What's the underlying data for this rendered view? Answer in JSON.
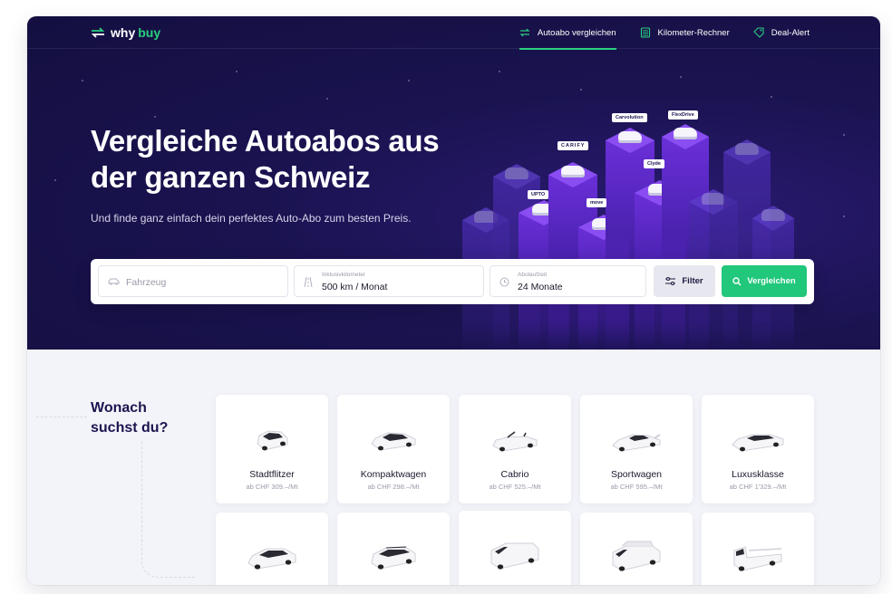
{
  "brand": {
    "name_part1": "why",
    "name_part2": "buy"
  },
  "nav": {
    "items": [
      {
        "label": "Autoabo vergleichen",
        "icon": "swap-arrows-icon",
        "active": true
      },
      {
        "label": "Kilometer-Rechner",
        "icon": "calculator-icon",
        "active": false
      },
      {
        "label": "Deal-Alert",
        "icon": "tag-icon",
        "active": false
      }
    ]
  },
  "hero": {
    "title": "Vergleiche Autoabos aus der ganzen Schweiz",
    "subtitle": "Und finde ganz einfach dein perfektes Auto-Abo zum besten Preis."
  },
  "illustration": {
    "brands": [
      "Carvolution",
      "FlexDrive",
      "CARIFY",
      "Clyde",
      "UPTO",
      "move"
    ]
  },
  "search": {
    "vehicle": {
      "placeholder": "Fahrzeug"
    },
    "km": {
      "label": "Inklusivkilometer",
      "value": "500 km / Monat"
    },
    "duration": {
      "label": "Abolaufzeit",
      "value": "24 Monate"
    },
    "filter_label": "Filter",
    "compare_label": "Vergleichen"
  },
  "categories": {
    "title_line1": "Wonach",
    "title_line2": "suchst du?",
    "items": [
      {
        "name": "Stadtflitzer",
        "price": "ab CHF 309.–/Mt"
      },
      {
        "name": "Kompaktwagen",
        "price": "ab CHF 298.–/Mt"
      },
      {
        "name": "Cabrio",
        "price": "ab CHF 525.–/Mt"
      },
      {
        "name": "Sportwagen",
        "price": "ab CHF 595.–/Mt"
      },
      {
        "name": "Luxusklasse",
        "price": "ab CHF 1'329.–/Mt"
      }
    ]
  },
  "colors": {
    "hero_bg": "#140f40",
    "accent_green": "#21c77a",
    "tower_purple": "#6a2fd8"
  }
}
